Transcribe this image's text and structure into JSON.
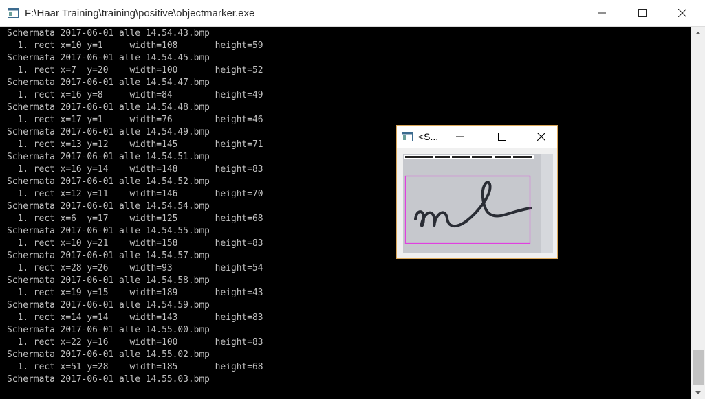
{
  "console_window": {
    "title": "F:\\Haar Training\\training\\positive\\objectmarker.exe",
    "controls": [
      "minimize",
      "maximize",
      "close"
    ],
    "lines": [
      "Schermata 2017-06-01 alle 14.54.43.bmp",
      "  1. rect x=10 y=1     width=108       height=59",
      "Schermata 2017-06-01 alle 14.54.45.bmp",
      "  1. rect x=7  y=20    width=100       height=52",
      "Schermata 2017-06-01 alle 14.54.47.bmp",
      "  1. rect x=16 y=8     width=84        height=49",
      "Schermata 2017-06-01 alle 14.54.48.bmp",
      "  1. rect x=17 y=1     width=76        height=46",
      "Schermata 2017-06-01 alle 14.54.49.bmp",
      "  1. rect x=13 y=12    width=145       height=71",
      "Schermata 2017-06-01 alle 14.54.51.bmp",
      "  1. rect x=16 y=14    width=148       height=83",
      "Schermata 2017-06-01 alle 14.54.52.bmp",
      "  1. rect x=12 y=11    width=146       height=70",
      "Schermata 2017-06-01 alle 14.54.54.bmp",
      "  1. rect x=6  y=17    width=125       height=68",
      "Schermata 2017-06-01 alle 14.54.55.bmp",
      "  1. rect x=10 y=21    width=158       height=83",
      "Schermata 2017-06-01 alle 14.54.57.bmp",
      "  1. rect x=28 y=26    width=93        height=54",
      "Schermata 2017-06-01 alle 14.54.58.bmp",
      "  1. rect x=19 y=15    width=189       height=43",
      "Schermata 2017-06-01 alle 14.54.59.bmp",
      "  1. rect x=14 y=14    width=143       height=83",
      "Schermata 2017-06-01 alle 14.55.00.bmp",
      "  1. rect x=22 y=16    width=100       height=83",
      "Schermata 2017-06-01 alle 14.55.02.bmp",
      "  1. rect x=51 y=28    width=185       height=68",
      "Schermata 2017-06-01 alle 14.55.03.bmp"
    ]
  },
  "image_window": {
    "title": "<S...",
    "controls": [
      "minimize",
      "maximize",
      "close"
    ],
    "content": "handwritten signature sample with magenta selection rectangle"
  },
  "icons": {
    "app": "console-app-icon",
    "minimize": "minimize-icon",
    "maximize": "maximize-icon",
    "close": "close-icon",
    "scroll_up": "scroll-up-arrow-icon",
    "scroll_down": "scroll-down-arrow-icon"
  },
  "colors": {
    "console_background": "#000000",
    "console_text": "#c0c0c0",
    "selection_rect": "#e040e0",
    "image_window_border": "#dba85a"
  }
}
